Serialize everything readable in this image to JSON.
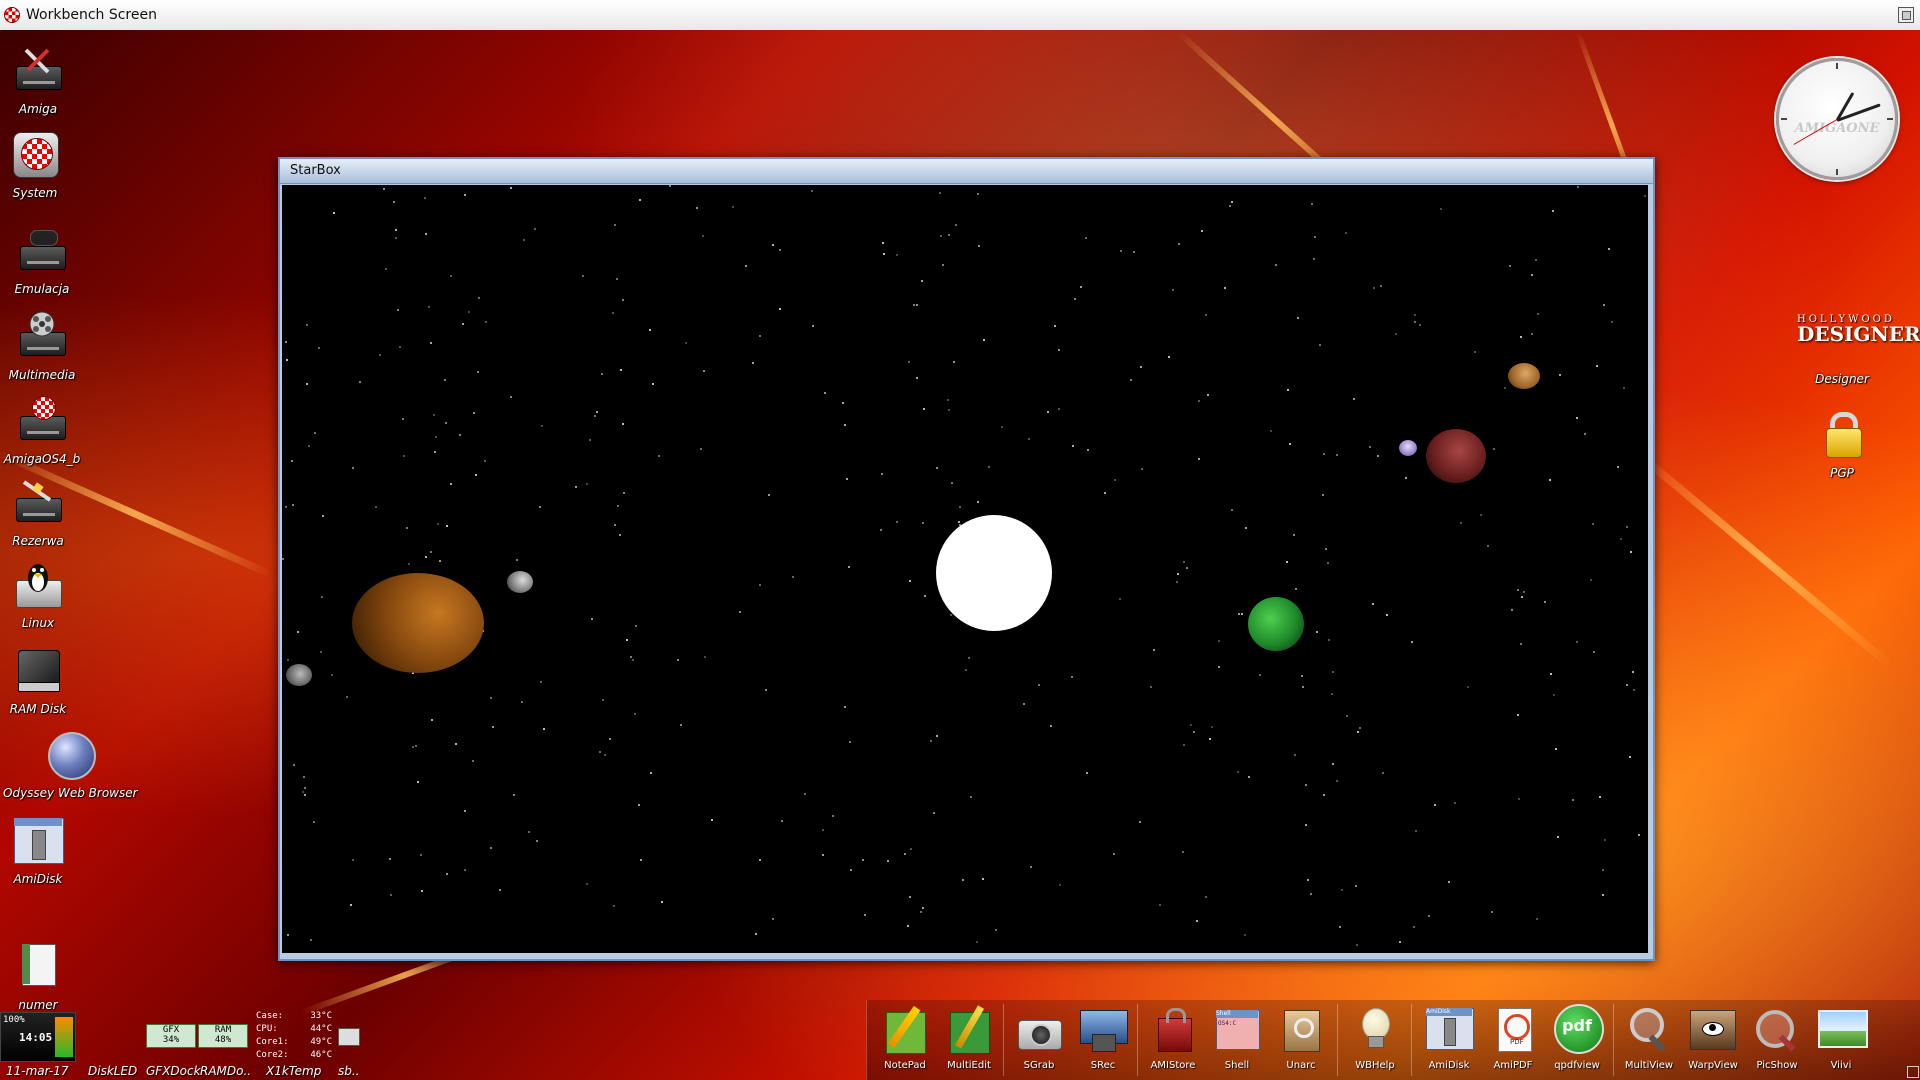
{
  "screen": {
    "title": "Workbench Screen"
  },
  "desktop_icons": [
    {
      "id": "amiga",
      "label": "Amiga"
    },
    {
      "id": "system",
      "label": "System"
    },
    {
      "id": "emulacja",
      "label": "Emulacja"
    },
    {
      "id": "multimedia",
      "label": "Multimedia"
    },
    {
      "id": "amigaos4",
      "label": "AmigaOS4_b"
    },
    {
      "id": "rezerwa",
      "label": "Rezerwa"
    },
    {
      "id": "linux",
      "label": "Linux"
    },
    {
      "id": "ramdisk",
      "label": "RAM Disk"
    },
    {
      "id": "odyssey",
      "label": "Odyssey Web Browser"
    },
    {
      "id": "amidisk",
      "label": "AmiDisk"
    },
    {
      "id": "numer",
      "label": "numer"
    },
    {
      "id": "designer",
      "label": "Designer"
    },
    {
      "id": "pgp",
      "label": "PGP"
    }
  ],
  "designer_logo": {
    "line1": "HOLLYWOOD",
    "line2": "DESIGNER"
  },
  "clock": {
    "brand": "AMIGAONE"
  },
  "window": {
    "title": "StarBox"
  },
  "accent_colors": {
    "window_border": "#6f92c4",
    "title_gradient_top": "#e8eef7"
  },
  "left_dock": {
    "battery": "100%",
    "time": "14:05",
    "date": "11-mar-17",
    "diskled": "DiskLED",
    "gfxdock": "GFXDock",
    "ramdock": "RAMDo..",
    "x1ktemp": "X1kTemp",
    "sb": "sb..",
    "gfx_label": "GFX",
    "gfx_value": "34%",
    "ram_label": "RAM",
    "ram_value": "48%",
    "temps": [
      {
        "label": "Case:",
        "value": "33°C"
      },
      {
        "label": "CPU:",
        "value": "44°C"
      },
      {
        "label": "Core1:",
        "value": "49°C"
      },
      {
        "label": "Core2:",
        "value": "46°C"
      }
    ]
  },
  "dock_items": [
    {
      "label": "NotePad",
      "icon": "pencil-notepad-icon"
    },
    {
      "label": "MultiEdit",
      "icon": "multiedit-icon"
    },
    {
      "label": "SGrab",
      "icon": "camera-icon"
    },
    {
      "label": "SRec",
      "icon": "screen-recorder-icon"
    },
    {
      "label": "AMIStore",
      "icon": "shopping-bag-icon"
    },
    {
      "label": "Shell",
      "icon": "shell-window-icon",
      "mini": "Shell",
      "mini2": "OS4:C"
    },
    {
      "label": "Unarc",
      "icon": "archive-box-icon"
    },
    {
      "label": "WBHelp",
      "icon": "lightbulb-icon"
    },
    {
      "label": "AmiDisk",
      "icon": "amidisk-icon",
      "mini": "AmiDisk"
    },
    {
      "label": "AmiPDF",
      "icon": "pdf-document-icon",
      "mini": "PDF"
    },
    {
      "label": "qpdfview",
      "icon": "pdf-green-icon",
      "mini": "pdf"
    },
    {
      "label": "MultiView",
      "icon": "magnifier-icon"
    },
    {
      "label": "WarpView",
      "icon": "eye-image-icon"
    },
    {
      "label": "PicShow",
      "icon": "picture-magnifier-icon"
    },
    {
      "label": "Viivi",
      "icon": "image-viewer-icon"
    }
  ]
}
